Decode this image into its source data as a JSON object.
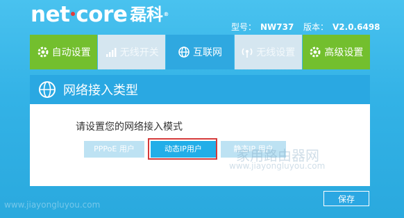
{
  "brand": {
    "name": "net",
    "name_tail": "core",
    "cn": "磊科",
    "reg": "®"
  },
  "meta": {
    "model_label": "型号：",
    "model_value": "NW737",
    "version_label": "版本：",
    "version_value": "V2.0.6498"
  },
  "nav": [
    {
      "label": "自动设置",
      "icon": "gear-icon",
      "style": "green"
    },
    {
      "label": "无线开关",
      "icon": "signal-bars-icon",
      "style": "light"
    },
    {
      "label": "互联网",
      "icon": "globe-icon",
      "style": "blue"
    },
    {
      "label": "无线设置",
      "icon": "wifi-antenna-icon",
      "style": "light"
    },
    {
      "label": "高级设置",
      "icon": "gear-icon",
      "style": "green"
    }
  ],
  "section": {
    "title": "网络接入类型",
    "icon": "globe-icon"
  },
  "panel": {
    "prompt": "请设置您的网络接入模式",
    "modes": [
      {
        "label": "PPPoE 用户"
      },
      {
        "label": "动态IP用户"
      },
      {
        "label": "静态IP 用户"
      }
    ],
    "selected_mode": "动态IP用户"
  },
  "actions": {
    "save_label": "保存"
  },
  "watermarks": {
    "cn": "家用路由器网",
    "url": "www.jiayongluyou.com"
  },
  "colors": {
    "green": "#73bf2e",
    "blue": "#2aa8e2",
    "highlight": "#d43a3a"
  }
}
